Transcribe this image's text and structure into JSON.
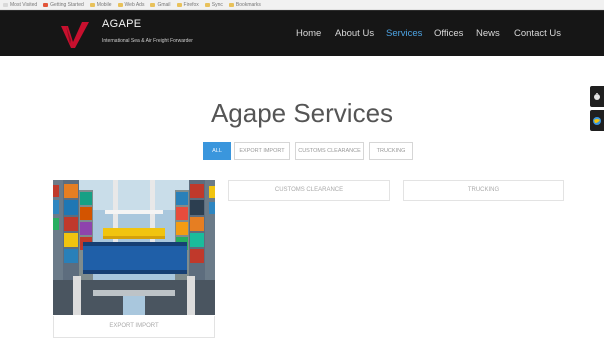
{
  "bookmarks": [
    {
      "label": "Most Visited",
      "color": "#d9d9d9"
    },
    {
      "label": "Getting Started",
      "color": "#e2553a"
    },
    {
      "label": "Mobile",
      "color": "#e8c15a"
    },
    {
      "label": "Web Ads",
      "color": "#e8c15a"
    },
    {
      "label": "Gmail",
      "color": "#e8c15a"
    },
    {
      "label": "Firefox",
      "color": "#e8c15a"
    },
    {
      "label": "Sync",
      "color": "#e8c15a"
    },
    {
      "label": "Bookmarks",
      "color": "#e8c15a"
    }
  ],
  "brand": {
    "name": "AGAPE",
    "tagline": "International Sea & Air Freight Forwarder",
    "logo_color": "#c8102e"
  },
  "nav": {
    "items": [
      {
        "label": "Home"
      },
      {
        "label": "About Us"
      },
      {
        "label": "Services"
      },
      {
        "label": "Offices"
      },
      {
        "label": "News"
      },
      {
        "label": "Contact Us"
      }
    ],
    "active_index": 2,
    "active_color": "#4da3e3"
  },
  "page": {
    "title": "Agape Services"
  },
  "filters": {
    "items": [
      {
        "label": "ALL"
      },
      {
        "label": "EXPORT IMPORT"
      },
      {
        "label": "CUSTOMS CLEARANCE"
      },
      {
        "label": "TRUCKING"
      }
    ],
    "active_index": 0,
    "active_color": "#3a96dd"
  },
  "services": {
    "export_import": {
      "label": "EXPORT IMPORT"
    },
    "customs_clearance": {
      "label": "CUSTOMS CLEARANCE"
    },
    "trucking": {
      "label": "TRUCKING"
    }
  }
}
